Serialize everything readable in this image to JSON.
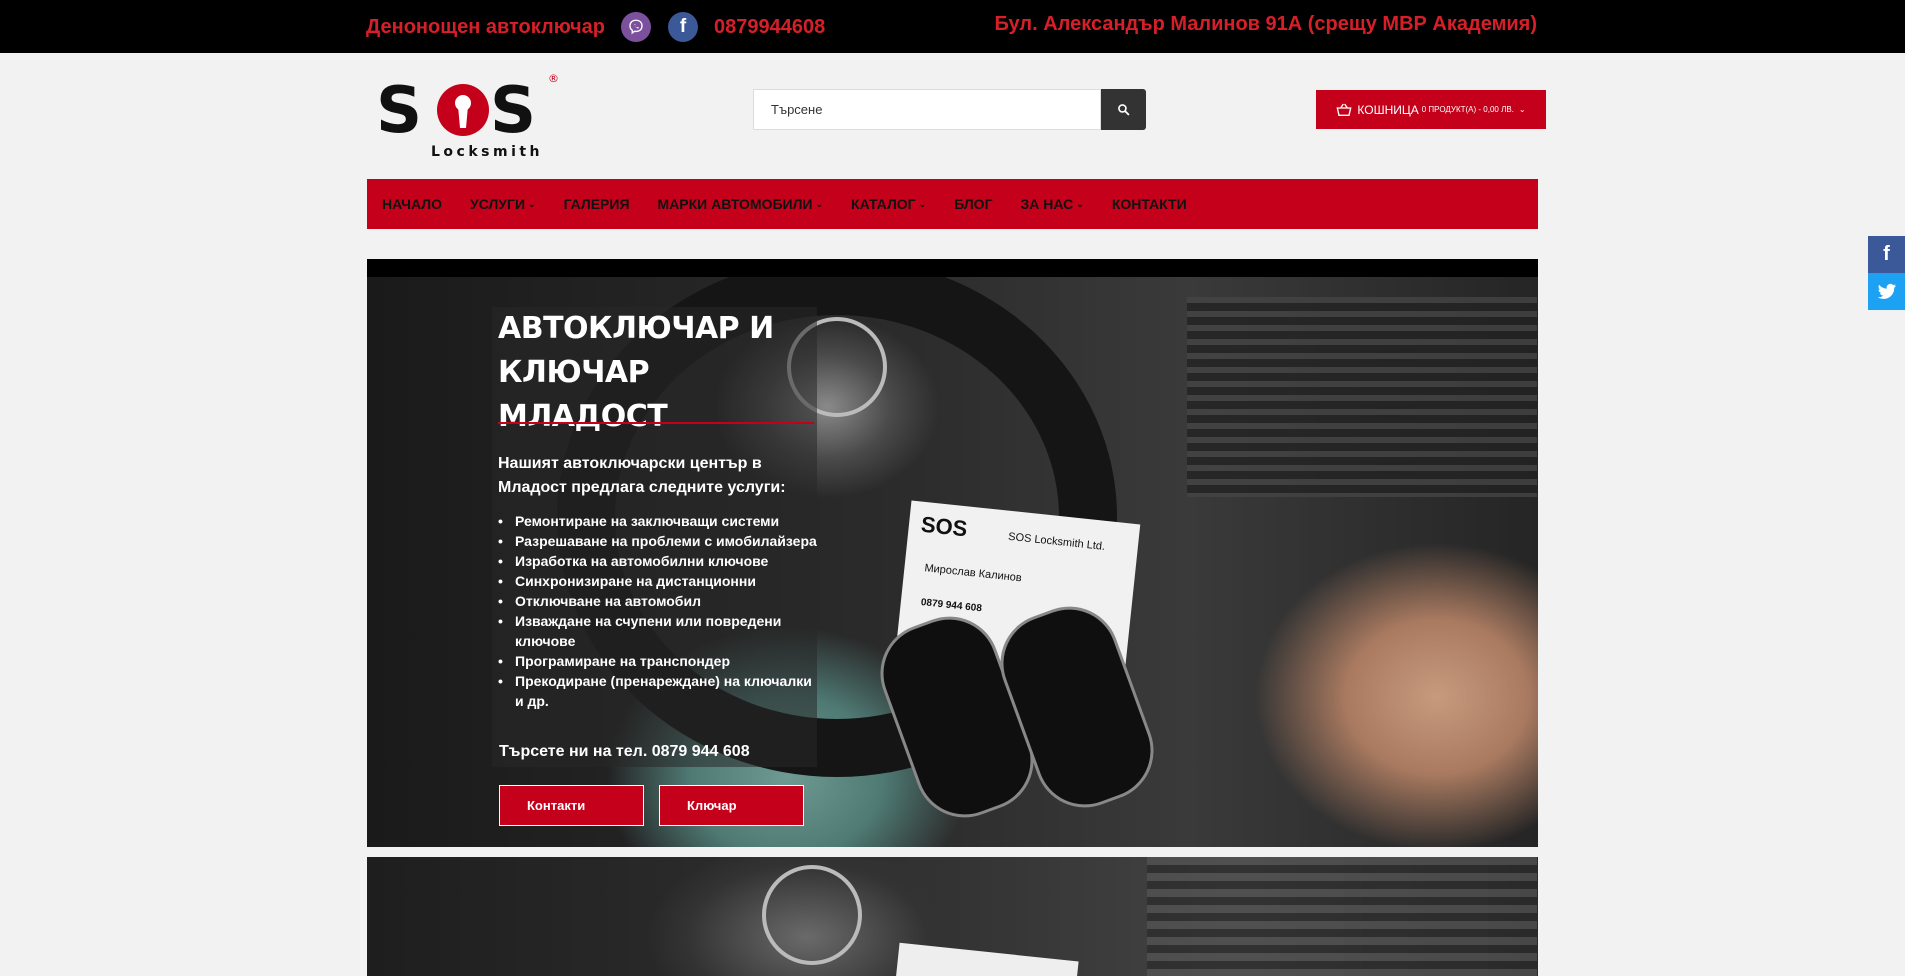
{
  "topbar": {
    "title": "Денонощен автоключар",
    "phone": "0879944608",
    "address": "Бул. Александър Малинов 91А (срещу МВР Академия)",
    "icons": [
      "viber-icon",
      "facebook-icon"
    ]
  },
  "logo": {
    "name": "SOS",
    "tagline": "Locksmith",
    "registered": "®"
  },
  "search": {
    "placeholder": "Търсене"
  },
  "cart": {
    "label": "КОШНИЦА",
    "info": "0 ПРОДУКТ(А) - 0,00 ЛВ."
  },
  "nav": {
    "items": [
      {
        "label": "НАЧАЛО",
        "dropdown": false
      },
      {
        "label": "УСЛУГИ",
        "dropdown": true
      },
      {
        "label": "ГАЛЕРИЯ",
        "dropdown": false
      },
      {
        "label": "МАРКИ АВТОМОБИЛИ",
        "dropdown": true
      },
      {
        "label": "КАТАЛОГ",
        "dropdown": true
      },
      {
        "label": "БЛОГ",
        "dropdown": false
      },
      {
        "label": "ЗА НАС",
        "dropdown": true
      },
      {
        "label": "КОНТАКТИ",
        "dropdown": false
      }
    ]
  },
  "hero": {
    "title_line1": "АВТОКЛЮЧАР И",
    "title_line2": "КЛЮЧАР МЛАДОСТ",
    "intro": "Нашият автоключарски център в Младост предлага следните услуги:",
    "services": [
      "Ремонтиране на заключващи системи",
      "Разрешаване на проблеми с имобилайзера",
      "Изработка на автомобилни ключове",
      "Синхронизиране на дистанционни",
      "Отключване на автомобил",
      "Изваждане на счупени или повредени ключове",
      "Програмиране на транспондер",
      "Прекодиране (пренареждане) на ключалки и др."
    ],
    "phone_line": "Търсете ни на тел. 0879 944 608",
    "buttons": {
      "contacts": "Контакти",
      "locksmith": "Ключар"
    },
    "card_logo": "SOS",
    "card_company": "SOS Locksmith Ltd.",
    "card_person": "Мирослав Калинов",
    "card_phone": "0879 944 608"
  },
  "colors": {
    "accent": "#c4001a",
    "topbar_text": "#d61f28",
    "topbar_bg": "#000000",
    "facebook": "#3b5998",
    "twitter": "#1da1f2",
    "viber": "#7b519d"
  }
}
